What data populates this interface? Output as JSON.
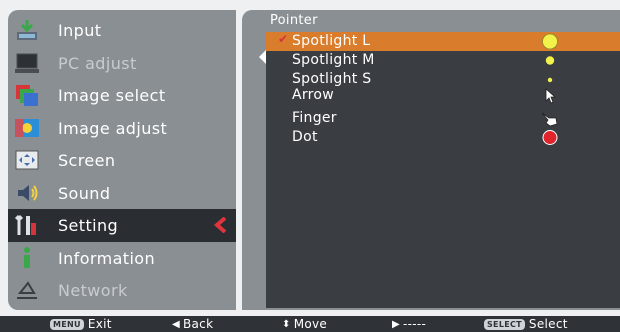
{
  "menu": {
    "items": [
      {
        "label": "Input",
        "icon": "input-icon"
      },
      {
        "label": "PC adjust",
        "icon": "pc-adjust-icon"
      },
      {
        "label": "Image select",
        "icon": "image-select-icon"
      },
      {
        "label": "Image adjust",
        "icon": "image-adjust-icon"
      },
      {
        "label": "Screen",
        "icon": "screen-icon"
      },
      {
        "label": "Sound",
        "icon": "sound-icon"
      },
      {
        "label": "Setting",
        "icon": "setting-icon"
      },
      {
        "label": "Information",
        "icon": "information-icon"
      },
      {
        "label": "Network",
        "icon": "network-icon"
      }
    ],
    "active_index": 6
  },
  "submenu": {
    "title": "Pointer",
    "options": [
      {
        "label": "Spotlight L",
        "sample": "large-yellow-circle-icon",
        "selected": true
      },
      {
        "label": "Spotlight M",
        "sample": "medium-yellow-circle-icon"
      },
      {
        "label": "Spotlight S",
        "sample": "small-yellow-circle-icon"
      },
      {
        "label": "Arrow",
        "sample": "arrow-pointer-icon"
      },
      {
        "label": "Finger",
        "sample": "finger-pointer-icon"
      },
      {
        "label": "Dot",
        "sample": "red-dot-icon"
      }
    ]
  },
  "bottombar": {
    "exit_key": "MENU",
    "exit_label": "Exit",
    "back_label": "Back",
    "move_label": "Move",
    "next_label": "-----",
    "select_key": "SELECT",
    "select_label": "Select"
  },
  "colors": {
    "panel_bg": "#8a8f94",
    "inner_bg": "#3a3e43",
    "highlight": "#d97c2b",
    "active_item_bg": "#2a2d31",
    "accent_red": "#d6343c",
    "spot_yellow": "#f2f24a"
  }
}
